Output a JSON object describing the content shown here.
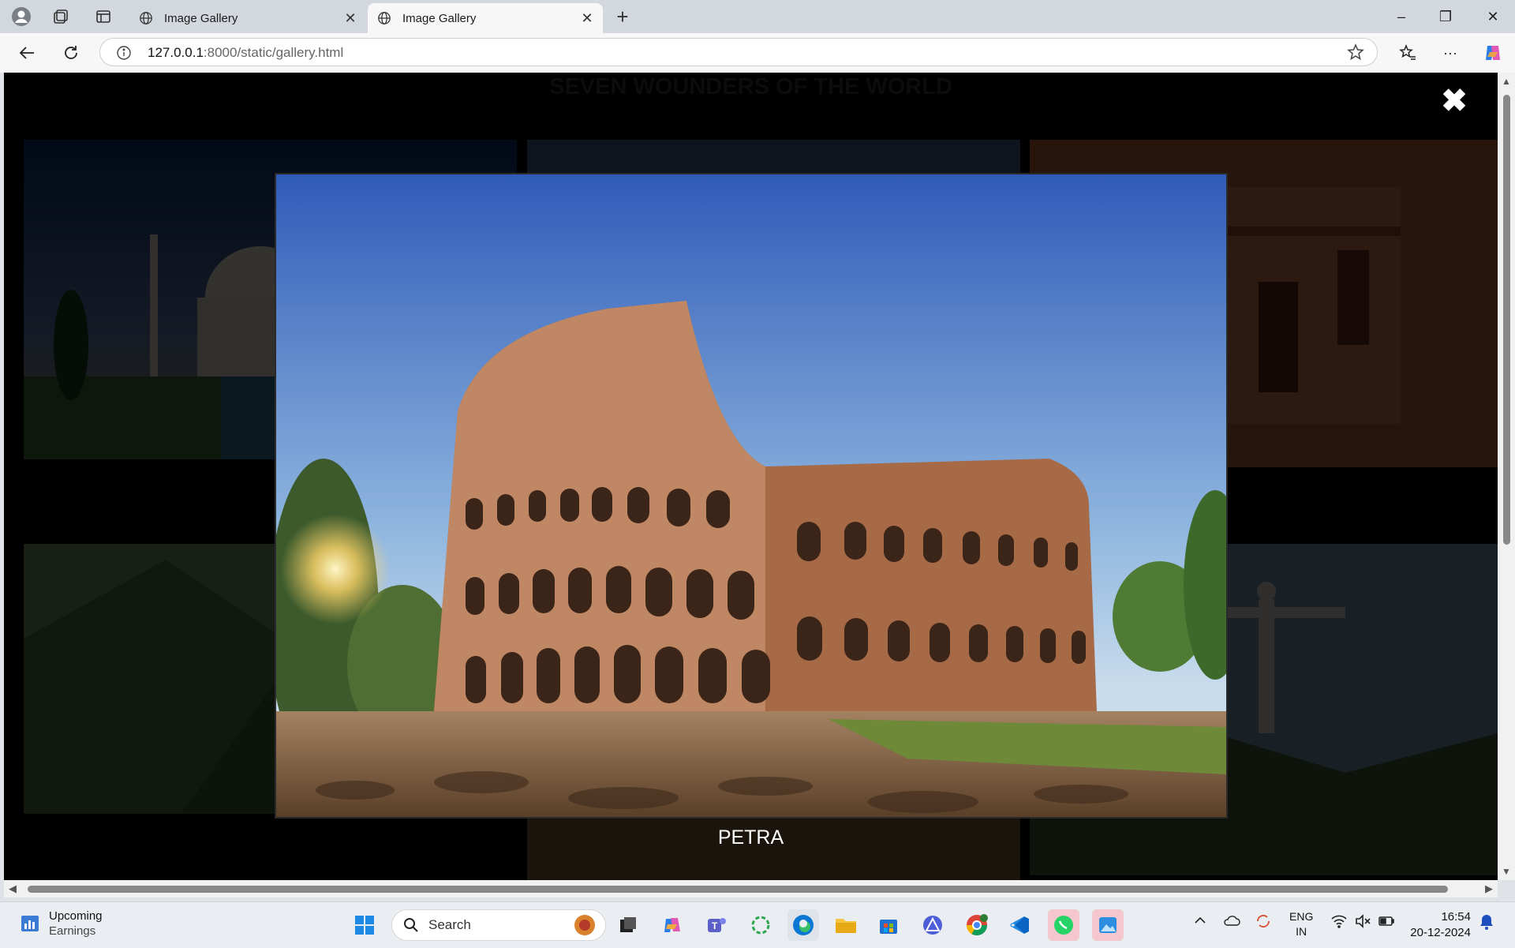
{
  "browser": {
    "tabs": [
      {
        "title": "Image Gallery",
        "active": false
      },
      {
        "title": "Image Gallery",
        "active": true
      }
    ],
    "address": {
      "host": "127.0.0.1",
      "path": ":8000/static/gallery.html"
    },
    "window_controls": {
      "minimize": "–",
      "restore": "❐",
      "close": "✕"
    },
    "more_label": "···"
  },
  "page": {
    "heading": "SEVEN WOUNDERS OF THE WORLD",
    "lightbox": {
      "caption": "PETRA",
      "close_symbol": "✖"
    },
    "accent_colors": {
      "overlay": "#000000",
      "caption_text": "#ffffff"
    }
  },
  "taskbar": {
    "weather": {
      "title": "Upcoming",
      "subtitle": "Earnings"
    },
    "search_placeholder": "Search",
    "tray": {
      "lang_top": "ENG",
      "lang_bottom": "IN"
    },
    "clock": {
      "time": "16:54",
      "date": "20-12-2024"
    }
  }
}
